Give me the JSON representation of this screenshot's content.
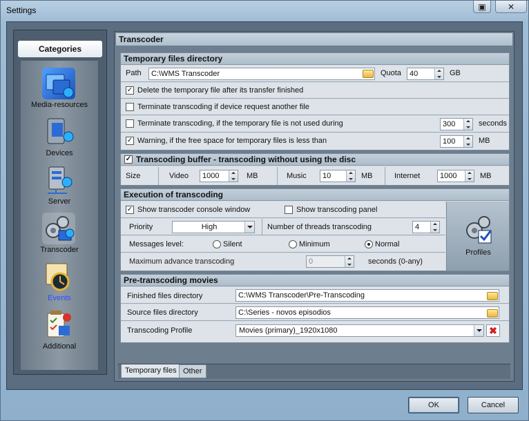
{
  "window": {
    "title": "Settings"
  },
  "sidebar": {
    "header": "Categories",
    "items": [
      {
        "label": "Media-resources",
        "icon": "media-resources-icon"
      },
      {
        "label": "Devices",
        "icon": "devices-icon"
      },
      {
        "label": "Server",
        "icon": "server-icon"
      },
      {
        "label": "Transcoder",
        "icon": "transcoder-icon"
      },
      {
        "label": "Events",
        "icon": "events-icon"
      },
      {
        "label": "Additional",
        "icon": "additional-icon"
      }
    ],
    "selected": "Transcoder"
  },
  "panel": {
    "title": "Transcoder"
  },
  "temp": {
    "title": "Temporary files directory",
    "path_label": "Path",
    "path_value": "C:\\WMS Transcoder",
    "quota_label": "Quota",
    "quota_value": "40",
    "quota_unit": "GB",
    "delete_label": "Delete the temporary file after its transfer finished",
    "delete_checked": true,
    "terminate_request_label": "Terminate transcoding if device request another file",
    "terminate_request_checked": false,
    "terminate_unused_label": "Terminate transcoding, if the temporary file is not used during",
    "terminate_unused_checked": false,
    "terminate_unused_value": "300",
    "terminate_unused_unit": "seconds",
    "warning_label": "Warning, if the free space for temporary files is less than",
    "warning_checked": true,
    "warning_value": "100",
    "warning_unit": "MB"
  },
  "buffer": {
    "title": "Transcoding buffer  - transcoding without using the disc",
    "checked": true,
    "size_label": "Size",
    "video_label": "Video",
    "video_value": "1000",
    "video_unit": "MB",
    "music_label": "Music",
    "music_value": "10",
    "music_unit": "MB",
    "internet_label": "Internet",
    "internet_value": "1000",
    "internet_unit": "MB"
  },
  "execution": {
    "title": "Execution of transcoding",
    "console_label": "Show transcoder console window",
    "console_checked": true,
    "panel_label": "Show transcoding panel",
    "panel_checked": false,
    "priority_label": "Priority",
    "priority_value": "High",
    "threads_label": "Number of threads transcoding",
    "threads_value": "4",
    "messages_label": "Messages level:",
    "msg_options": [
      "Silent",
      "Minimum",
      "Normal"
    ],
    "msg_selected": "Normal",
    "max_advance_label": "Maximum advance transcoding",
    "max_advance_value": "0",
    "max_advance_unit": "seconds (0-any)",
    "profiles_label": "Profiles"
  },
  "pre": {
    "title": "Pre-transcoding movies",
    "finished_label": "Finished files directory",
    "finished_value": "C:\\WMS Transcoder\\Pre-Transcoding",
    "source_label": "Source files directory",
    "source_value": "C:\\Series - novos episodios",
    "profile_label": "Transcoding Profile",
    "profile_value": "Movies (primary)_1920x1080"
  },
  "tabs": [
    "Temporary files",
    "Other"
  ],
  "buttons": {
    "ok": "OK",
    "cancel": "Cancel"
  }
}
